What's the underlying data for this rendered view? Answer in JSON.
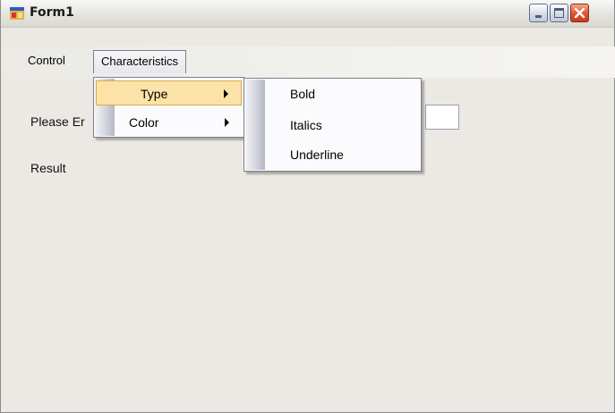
{
  "window": {
    "title": "Form1",
    "icon": "form-window-icon"
  },
  "menu": {
    "items": [
      {
        "label": "Control"
      },
      {
        "label": "Characteristics"
      }
    ],
    "characteristics_submenu": [
      {
        "label": "Type",
        "selected": true
      },
      {
        "label": "Color",
        "selected": false
      }
    ],
    "type_submenu": [
      {
        "label": "Bold"
      },
      {
        "label": "Italics"
      },
      {
        "label": "Underline"
      }
    ]
  },
  "form": {
    "enter_label": "Please Er",
    "result_label": "Result",
    "input_value": ""
  },
  "colors": {
    "selection": "#fbe3a7",
    "selection_border": "#d9aa48",
    "close_button": "#e05a37"
  }
}
